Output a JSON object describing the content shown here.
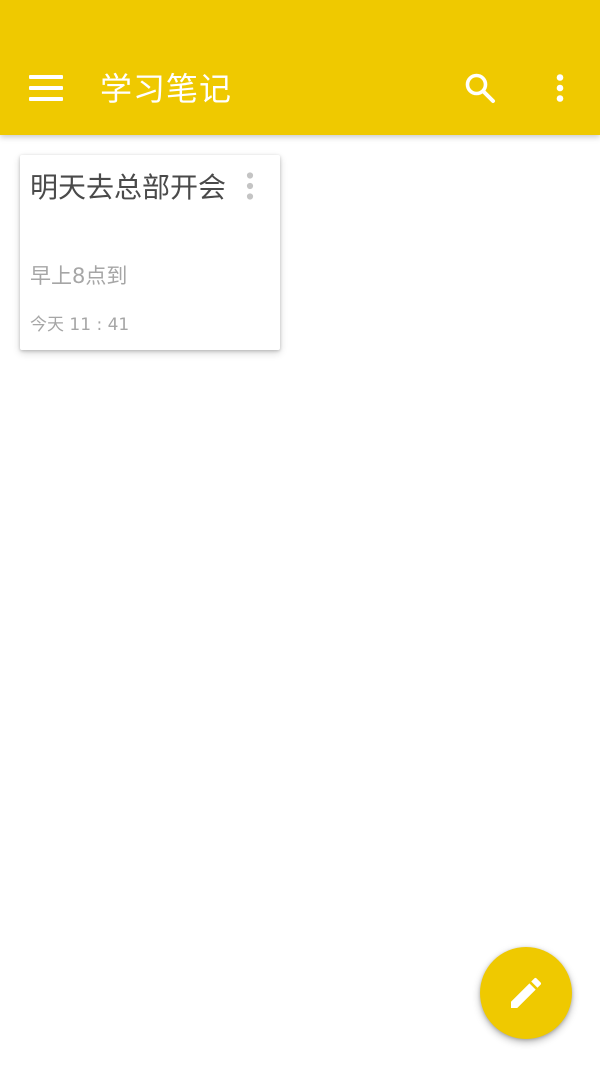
{
  "app_bar": {
    "title": "学习笔记",
    "background_color": "#efc900",
    "icons": {
      "menu": "menu-icon",
      "search": "search-icon",
      "overflow": "more-vert-icon"
    }
  },
  "notes": [
    {
      "title": "明天去总部开会",
      "body": "早上8点到",
      "date": "今天 11 : 41",
      "menu_icon": "more-vert-icon"
    }
  ],
  "fab": {
    "icon": "edit-pencil-icon",
    "color": "#efc900"
  }
}
